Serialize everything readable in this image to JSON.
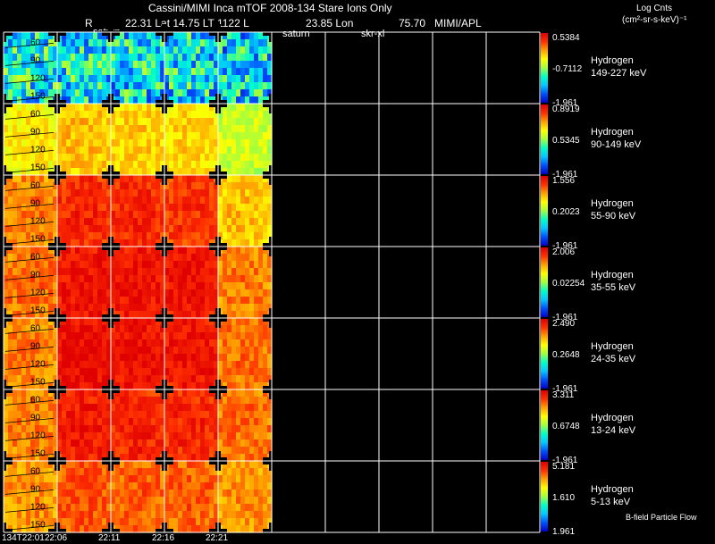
{
  "header": {
    "title": "Cassini/MIMI Inca mTOF  2008-134   Stare   Ions Only",
    "r_label": "R",
    "ephemeris": "22.31 Lat 14.75 LT 1122 L",
    "lon": "23.85 Lon",
    "misc_value": "75.70",
    "org": "MIMI/APL",
    "tag_saturn_a": "saturn",
    "tag_saturn_b": "saturn",
    "tag_skrot": "skr-xl"
  },
  "legend": {
    "title": "Log Cnts",
    "units": "(cm²-sr-s-keV)⁻¹"
  },
  "footnote": "B-field Particle Flow",
  "colors": {
    "background": "#000000",
    "grid": "#ffffff",
    "text": "#ffffff"
  },
  "chart_data": {
    "type": "heatmap",
    "colormap": [
      "#0000c8",
      "#0050ff",
      "#00c8ff",
      "#00ffc8",
      "#a0ff40",
      "#ffff00",
      "#ffa000",
      "#ff3000",
      "#e00000"
    ],
    "time_ticks": [
      "134T22:01",
      "22:06",
      "22:11",
      "22:16",
      "22:21"
    ],
    "filled_time_columns": 5,
    "total_time_columns": 10,
    "y_ticks": [
      "60",
      "90",
      "120",
      "150"
    ],
    "panels": [
      {
        "species": "Hydrogen",
        "energy": "149-227 keV",
        "cb_max": "0.5384",
        "cb_mid": "-0.7112",
        "cb_min": "-1.961",
        "col_levels": [
          0.3,
          0.28,
          0.27,
          0.28,
          0.25
        ]
      },
      {
        "species": "Hydrogen",
        "energy": "90-149 keV",
        "cb_max": "0.8919",
        "cb_mid": "0.5345",
        "cb_min": "-1.961",
        "col_levels": [
          0.6,
          0.66,
          0.64,
          0.63,
          0.52
        ]
      },
      {
        "species": "Hydrogen",
        "energy": "55-90 keV",
        "cb_max": "1.556",
        "cb_mid": "0.2023",
        "cb_min": "-1.961",
        "col_levels": [
          0.74,
          0.86,
          0.86,
          0.84,
          0.66
        ]
      },
      {
        "species": "Hydrogen",
        "energy": "35-55 keV",
        "cb_max": "2.006",
        "cb_mid": "0.02254",
        "cb_min": "-1.961",
        "col_levels": [
          0.76,
          0.9,
          0.9,
          0.9,
          0.74
        ]
      },
      {
        "species": "Hydrogen",
        "energy": "24-35 keV",
        "cb_max": "2.490",
        "cb_mid": "0.2648",
        "cb_min": "-1.961",
        "col_levels": [
          0.74,
          0.92,
          0.91,
          0.9,
          0.76
        ]
      },
      {
        "species": "Hydrogen",
        "energy": "13-24 keV",
        "cb_max": "3.311",
        "cb_mid": "0.6748",
        "cb_min": "-1.961",
        "col_levels": [
          0.74,
          0.88,
          0.87,
          0.86,
          0.76
        ]
      },
      {
        "species": "Hydrogen",
        "energy": "5-13 keV",
        "cb_max": "5.181",
        "cb_mid": "1.610",
        "cb_min": "1.961",
        "col_levels": [
          0.72,
          0.8,
          0.78,
          0.78,
          0.72
        ]
      }
    ]
  }
}
